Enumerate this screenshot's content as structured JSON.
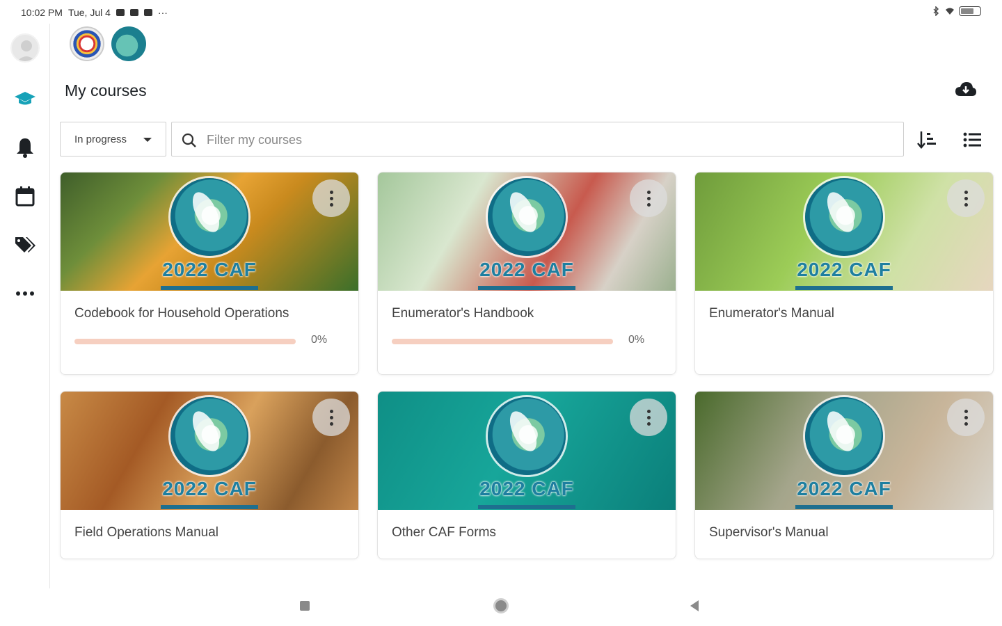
{
  "status_bar": {
    "time": "10:02 PM",
    "date": "Tue, Jul 4",
    "overflow": "···",
    "battery": "80"
  },
  "nav_rail": {
    "items": [
      {
        "icon": "graduation-cap-icon",
        "active": true
      },
      {
        "icon": "bell-icon",
        "active": false
      },
      {
        "icon": "calendar-icon",
        "active": false
      },
      {
        "icon": "tag-icon",
        "active": false
      },
      {
        "icon": "more-horizontal-icon",
        "active": false
      }
    ],
    "accent_color": "#17a2b8"
  },
  "page": {
    "title": "My courses"
  },
  "filters": {
    "status_selected": "In progress",
    "search_placeholder": "Filter my courses"
  },
  "courses": [
    {
      "name": "Codebook for Household Operations",
      "banner_text": "2022 CAF",
      "progress": "0%",
      "show_progress": true
    },
    {
      "name": "Enumerator's Handbook",
      "banner_text": "2022 CAF",
      "progress": "0%",
      "show_progress": true
    },
    {
      "name": "Enumerator's Manual",
      "banner_text": "2022 CAF",
      "progress": "",
      "show_progress": false
    },
    {
      "name": "Field Operations Manual",
      "banner_text": "2022 CAF",
      "progress": "",
      "show_progress": false
    },
    {
      "name": "Other CAF Forms",
      "banner_text": "2022 CAF",
      "progress": "",
      "show_progress": false
    },
    {
      "name": "Supervisor's Manual",
      "banner_text": "2022 CAF",
      "progress": "",
      "show_progress": false
    }
  ],
  "colors": {
    "progress_track": "#f6cfc0",
    "text_primary": "#1d2125"
  }
}
